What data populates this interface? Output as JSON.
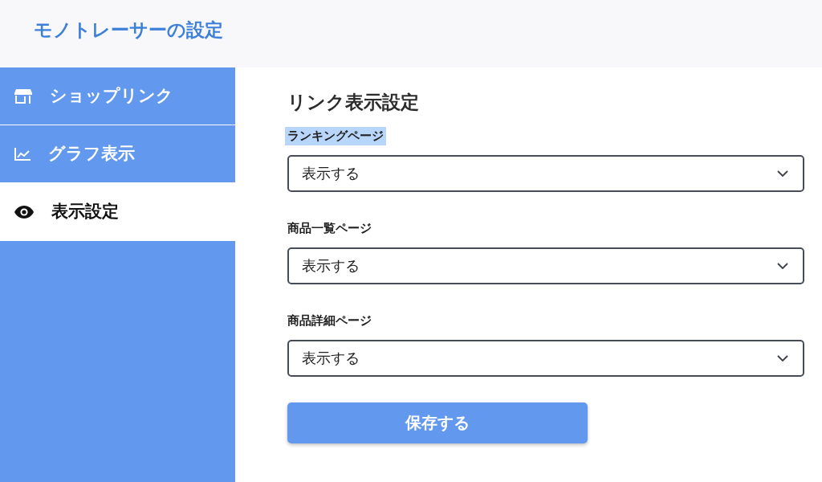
{
  "header": {
    "title": "モノトレーサーの設定"
  },
  "sidebar": {
    "items": [
      {
        "label": "ショップリンク",
        "selected": false
      },
      {
        "label": "グラフ表示",
        "selected": false
      },
      {
        "label": "表示設定",
        "selected": true
      }
    ]
  },
  "main": {
    "heading": "リンク表示設定",
    "fields": [
      {
        "label": "ランキングページ",
        "highlighted": true,
        "value": "表示する"
      },
      {
        "label": "商品一覧ページ",
        "highlighted": false,
        "value": "表示する"
      },
      {
        "label": "商品詳細ページ",
        "highlighted": false,
        "value": "表示する"
      }
    ],
    "save_button": "保存する"
  }
}
